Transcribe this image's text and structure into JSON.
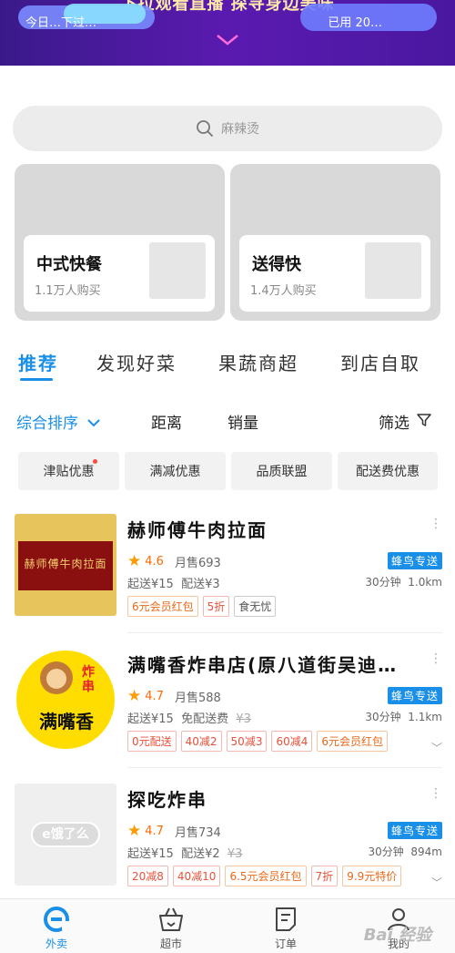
{
  "banner": {
    "headline": "下拉观看直播 探寻身边美味",
    "left_text": "今日…下过…",
    "right_text": "已用 20…"
  },
  "search": {
    "placeholder": "麻辣烫"
  },
  "cards": [
    {
      "title": "中式快餐",
      "subtitle": "1.1万人购买"
    },
    {
      "title": "送得快",
      "subtitle": "1.4万人购买"
    }
  ],
  "tabs": [
    "推荐",
    "发现好菜",
    "果蔬商超",
    "到店自取"
  ],
  "sort": {
    "default": "综合排序",
    "distance": "距离",
    "sales": "销量",
    "filter": "筛选"
  },
  "chips": [
    "津贴优惠",
    "满减优惠",
    "品质联盟",
    "配送费优惠"
  ],
  "stores": [
    {
      "name": "赫师傅牛肉拉面",
      "logo_text": "赫师傅牛肉拉面",
      "rating": "4.6",
      "monthly_sales": "月售693",
      "badge": "蜂鸟专送",
      "fee_start": "起送¥15",
      "fee_delivery": "配送¥3",
      "fee_original": "",
      "time": "30分钟",
      "distance": "1.0km",
      "tags": [
        "6元会员红包",
        "5折",
        "食无忧"
      ]
    },
    {
      "name": "满嘴香炸串店(原八道街吴迪…",
      "logo_text": "满嘴香",
      "logo_sub": "炸串",
      "rating": "4.7",
      "monthly_sales": "月售588",
      "badge": "蜂鸟专送",
      "fee_start": "起送¥15",
      "fee_delivery": "免配送费",
      "fee_original": "¥3",
      "time": "30分钟",
      "distance": "1.1km",
      "tags": [
        "0元配送",
        "40减2",
        "50减3",
        "60减4",
        "6元会员红包"
      ]
    },
    {
      "name": "探吃炸串",
      "logo_text": "e饿了么",
      "rating": "4.7",
      "monthly_sales": "月售734",
      "badge": "蜂鸟专送",
      "fee_start": "起送¥15",
      "fee_delivery": "配送¥2",
      "fee_original": "¥3",
      "time": "30分钟",
      "distance": "894m",
      "tags": [
        "20减8",
        "40减10",
        "6.5元会员红包",
        "7折",
        "9.9元特价"
      ]
    }
  ],
  "nav": [
    "外卖",
    "超市",
    "订单",
    "我的"
  ],
  "watermark": "Bai 经验",
  "colors": {
    "accent": "#1a8fe8",
    "banner": "#4a18a0",
    "price_red": "#e8503a"
  }
}
